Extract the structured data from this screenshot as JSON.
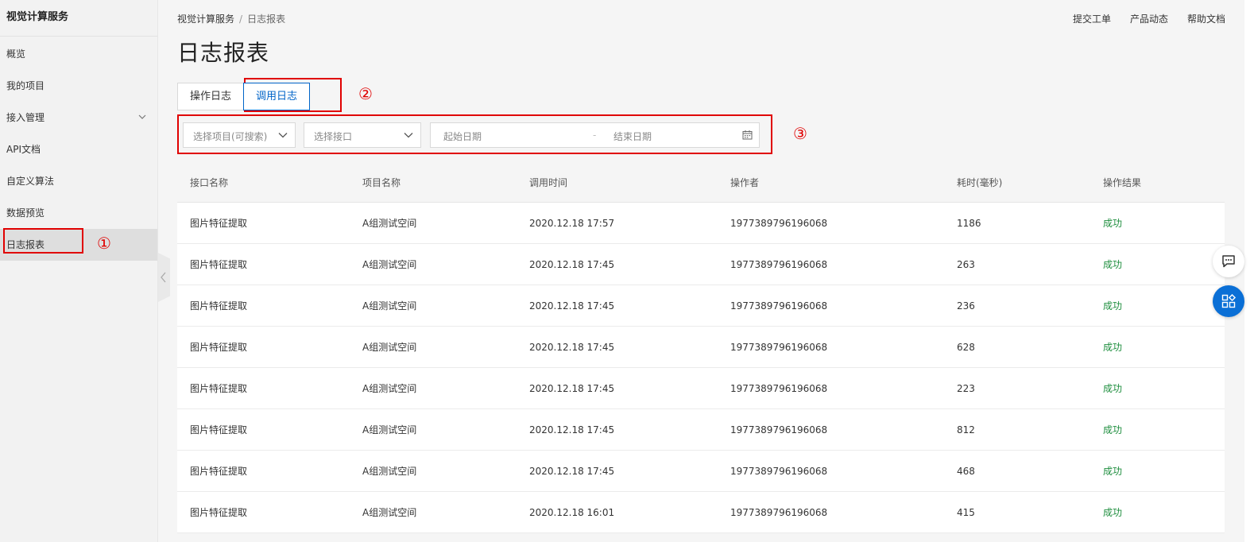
{
  "sidebar": {
    "title": "视觉计算服务",
    "items": [
      {
        "label": "概览"
      },
      {
        "label": "我的项目"
      },
      {
        "label": "接入管理"
      },
      {
        "label": "API文档"
      },
      {
        "label": "自定义算法"
      },
      {
        "label": "数据预览"
      },
      {
        "label": "日志报表"
      }
    ],
    "active_index": 6
  },
  "breadcrumb": {
    "root": "视觉计算服务",
    "sep": "/",
    "current": "日志报表"
  },
  "top_links": [
    "提交工单",
    "产品动态",
    "帮助文档"
  ],
  "page_title": "日志报表",
  "tabs": [
    {
      "label": "操作日志",
      "active": false
    },
    {
      "label": "调用日志",
      "active": true
    }
  ],
  "filters": {
    "project_placeholder": "选择项目(可搜索)",
    "api_placeholder": "选择接口",
    "start_date_placeholder": "起始日期",
    "date_separator": "-",
    "end_date_placeholder": "结束日期"
  },
  "annotations": {
    "one": "①",
    "two": "②",
    "three": "③"
  },
  "table": {
    "headers": {
      "api": "接口名称",
      "project": "项目名称",
      "time": "调用时间",
      "operator": "操作者",
      "duration": "耗时(毫秒)",
      "result": "操作结果"
    },
    "rows": [
      {
        "api": "图片特征提取",
        "project": "A组测试空间",
        "time": "2020.12.18 17:57",
        "operator": "1977389796196068",
        "duration": "1186",
        "result": "成功"
      },
      {
        "api": "图片特征提取",
        "project": "A组测试空间",
        "time": "2020.12.18 17:45",
        "operator": "1977389796196068",
        "duration": "263",
        "result": "成功"
      },
      {
        "api": "图片特征提取",
        "project": "A组测试空间",
        "time": "2020.12.18 17:45",
        "operator": "1977389796196068",
        "duration": "236",
        "result": "成功"
      },
      {
        "api": "图片特征提取",
        "project": "A组测试空间",
        "time": "2020.12.18 17:45",
        "operator": "1977389796196068",
        "duration": "628",
        "result": "成功"
      },
      {
        "api": "图片特征提取",
        "project": "A组测试空间",
        "time": "2020.12.18 17:45",
        "operator": "1977389796196068",
        "duration": "223",
        "result": "成功"
      },
      {
        "api": "图片特征提取",
        "project": "A组测试空间",
        "time": "2020.12.18 17:45",
        "operator": "1977389796196068",
        "duration": "812",
        "result": "成功"
      },
      {
        "api": "图片特征提取",
        "project": "A组测试空间",
        "time": "2020.12.18 17:45",
        "operator": "1977389796196068",
        "duration": "468",
        "result": "成功"
      },
      {
        "api": "图片特征提取",
        "project": "A组测试空间",
        "time": "2020.12.18 16:01",
        "operator": "1977389796196068",
        "duration": "415",
        "result": "成功"
      }
    ]
  },
  "colors": {
    "accent": "#0064c8",
    "annotation_red": "#e00000",
    "success_green": "#1e8e3e",
    "apps_button_blue": "#0a6fd6"
  },
  "icons": {
    "nav_expand": "chevron-down-icon",
    "collapse": "chevron-left-icon",
    "select": "chevron-down-icon",
    "date": "calendar-icon",
    "chat": "chat-icon",
    "apps": "apps-icon"
  }
}
